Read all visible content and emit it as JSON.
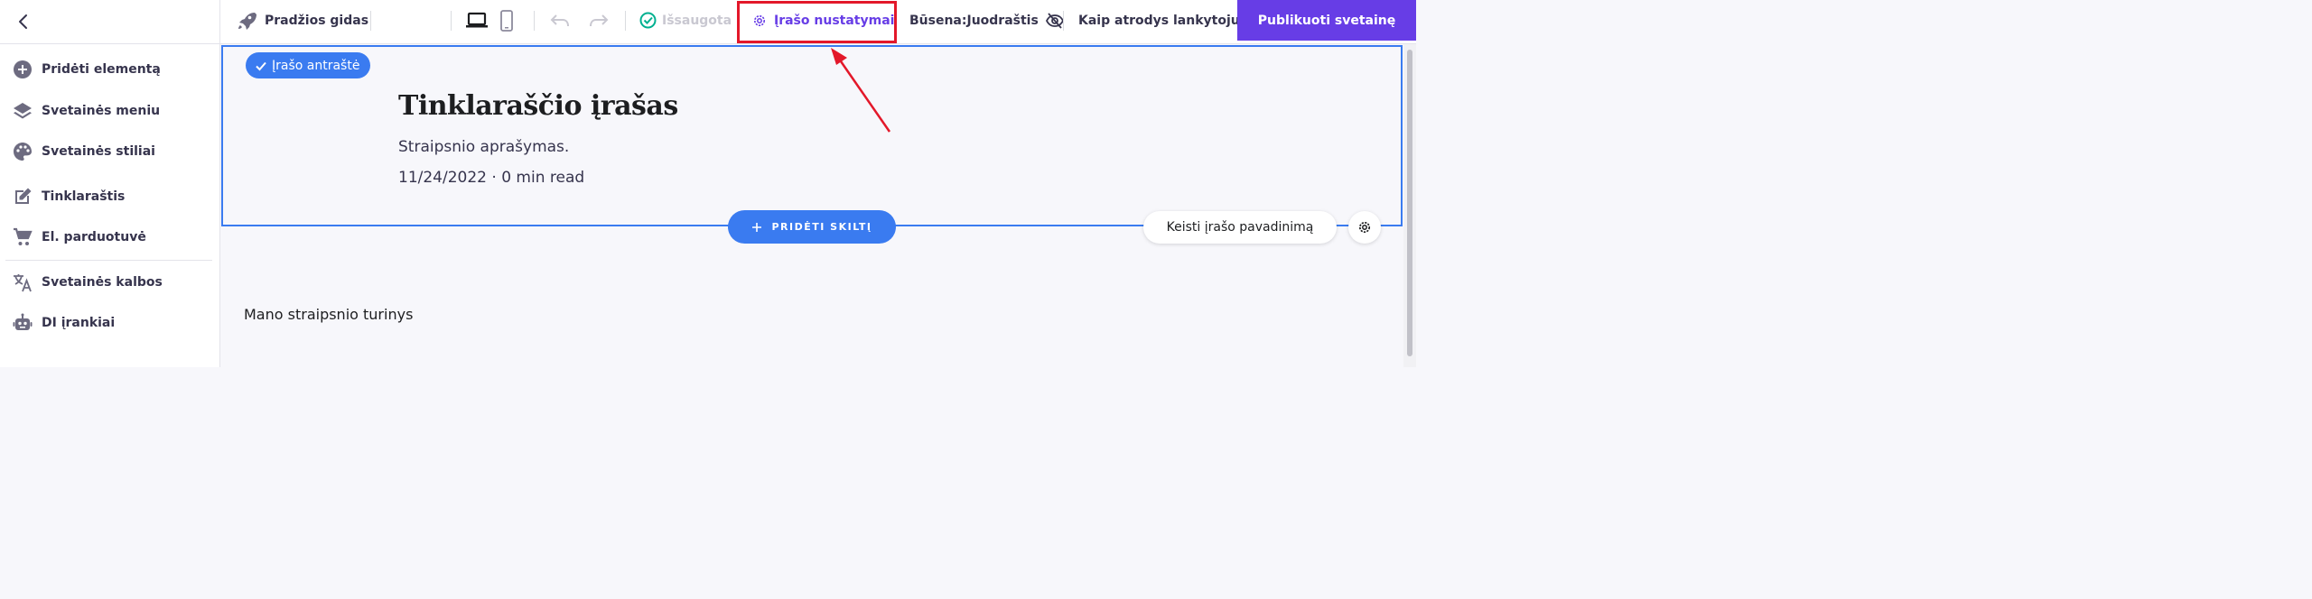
{
  "sidebar": {
    "items": [
      {
        "label": "Pridėti elementą",
        "icon": "plus-circle-icon"
      },
      {
        "label": "Svetainės meniu",
        "icon": "layers-icon"
      },
      {
        "label": "Svetainės stiliai",
        "icon": "palette-icon"
      },
      {
        "label": "Tinklaraštis",
        "icon": "edit-icon"
      },
      {
        "label": "El. parduotuvė",
        "icon": "cart-icon"
      },
      {
        "label": "Svetainės kalbos",
        "icon": "translate-icon"
      },
      {
        "label": "DI įrankiai",
        "icon": "robot-icon"
      }
    ]
  },
  "topbar": {
    "guide": "Pradžios gidas",
    "saved": "Išsaugota",
    "post_settings": "Įrašo nustatymai",
    "status": "Būsena:Juodraštis",
    "preview": "Kaip atrodys lankytojui",
    "publish": "Publikuoti svetainę"
  },
  "canvas": {
    "badge": "Įrašo antraštė",
    "title": "Tinklaraščio įrašas",
    "description": "Straipsnio aprašymas.",
    "meta": "11/24/2022 · 0 min read",
    "add_section": "PRIDĖTI SKILTĮ",
    "rename": "Keisti įrašo pavadinimą",
    "content": "Mano straipsnio turinys"
  },
  "colors": {
    "accent": "#673de6",
    "blue": "#3a7bf0",
    "highlight": "#e3182a",
    "saved_green": "#00b090"
  }
}
